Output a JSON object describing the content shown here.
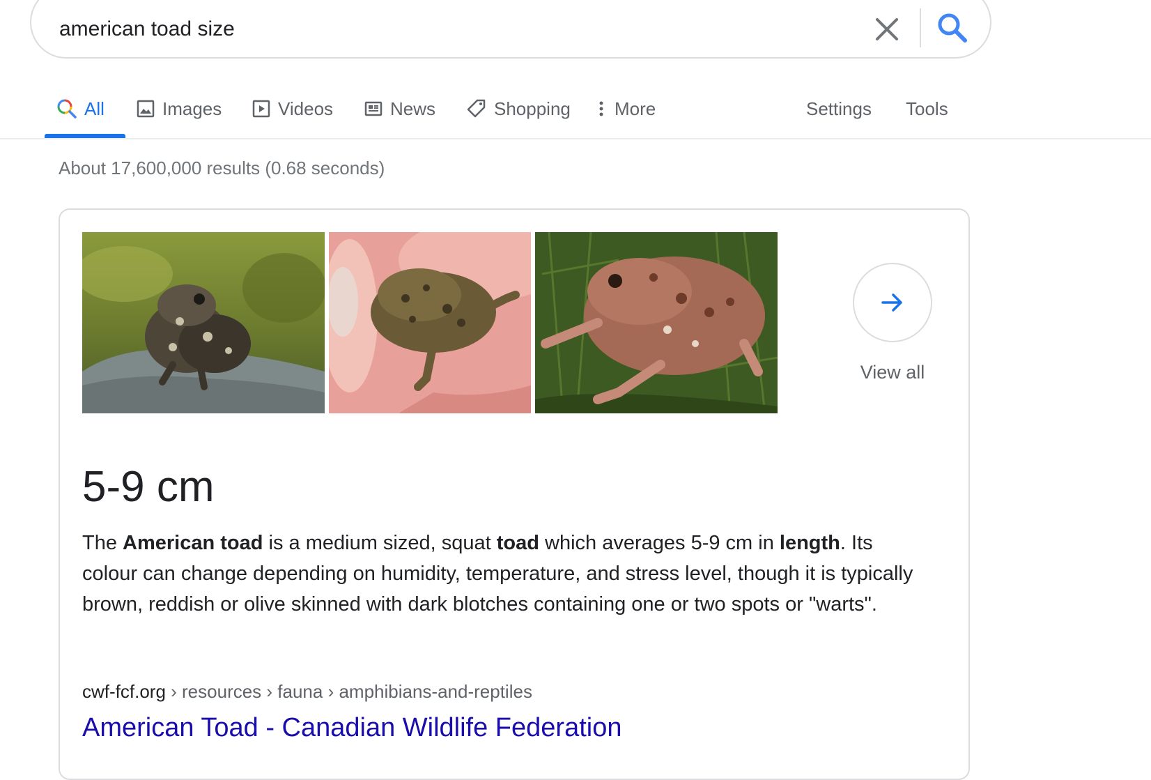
{
  "search": {
    "query": "american toad size"
  },
  "tabs": [
    {
      "label": "All",
      "icon": "search-icon",
      "active": true
    },
    {
      "label": "Images",
      "icon": "image-icon"
    },
    {
      "label": "Videos",
      "icon": "play-icon"
    },
    {
      "label": "News",
      "icon": "news-icon"
    },
    {
      "label": "Shopping",
      "icon": "tag-icon"
    },
    {
      "label": "More",
      "icon": "more-vert-icon"
    }
  ],
  "tools": {
    "settings_label": "Settings",
    "tools_label": "Tools"
  },
  "result_stats": "About 17,600,000 results (0.68 seconds)",
  "featured": {
    "view_all_label": "View all",
    "answer": "5-9 cm",
    "snippet": {
      "p1": "The ",
      "b1": "American toad",
      "p2": " is a medium sized, squat ",
      "b2": "toad",
      "p3": " which averages 5-9 cm in ",
      "b3": "length",
      "p4": ". Its colour can change depending on humidity, temperature, and stress level, though it is typically brown, reddish or olive skinned with dark blotches containing one or two spots or \"warts\"."
    },
    "cite_domain": "cwf-fcf.org",
    "cite_path": " › resources › fauna › amphibians-and-reptiles",
    "result_title": "American Toad - Canadian Wildlife Federation"
  },
  "colors": {
    "link": "#1a0dab",
    "accent": "#1a73e8",
    "muted": "#70757a"
  }
}
